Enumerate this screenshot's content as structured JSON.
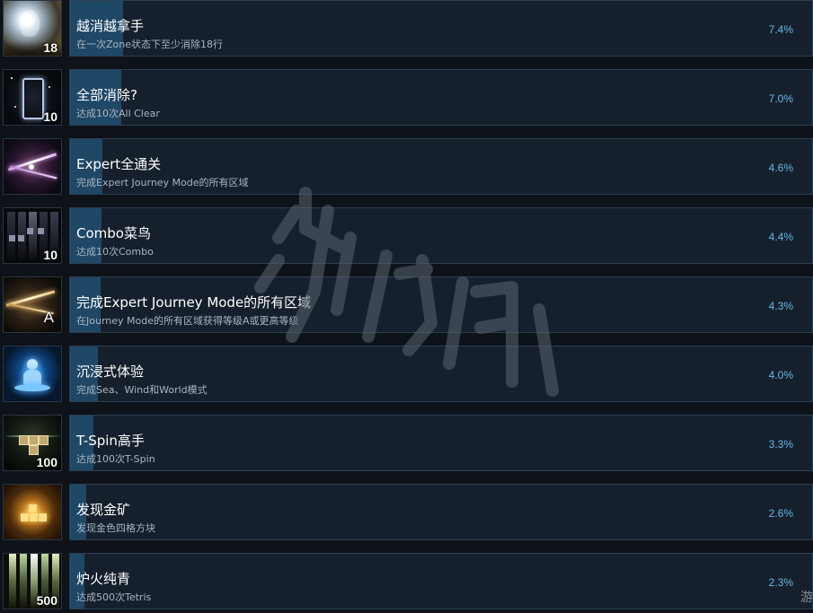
{
  "achievements": [
    {
      "title": "越消越拿手",
      "description": "在一次Zone状态下至少消除18行",
      "percent": "7.4%",
      "percent_value": 7.4,
      "icon": "head-glow-icon",
      "icon_number": "18"
    },
    {
      "title": "全部消除?",
      "description": "达成10次All Clear",
      "percent": "7.0%",
      "percent_value": 7.0,
      "icon": "empty-well-icon",
      "icon_number": "10"
    },
    {
      "title": "Expert全通关",
      "description": "完成Expert Journey Mode的所有区域",
      "percent": "4.6%",
      "percent_value": 4.6,
      "icon": "constellation-icon",
      "icon_number": ""
    },
    {
      "title": "Combo菜鸟",
      "description": "达成10次Combo",
      "percent": "4.4%",
      "percent_value": 4.4,
      "icon": "block-columns-icon",
      "icon_number": "10"
    },
    {
      "title": "完成Expert Journey Mode的所有区域",
      "description": "在Journey Mode的所有区域获得等级A或更高等级",
      "percent": "4.3%",
      "percent_value": 4.3,
      "icon": "constellation-grade-icon",
      "icon_number": "A"
    },
    {
      "title": "沉浸式体验",
      "description": "完成Sea、Wind和World模式",
      "percent": "4.0%",
      "percent_value": 4.0,
      "icon": "meditation-icon",
      "icon_number": ""
    },
    {
      "title": "T-Spin高手",
      "description": "达成100次T-Spin",
      "percent": "3.3%",
      "percent_value": 3.3,
      "icon": "t-piece-icon",
      "icon_number": "100"
    },
    {
      "title": "发现金矿",
      "description": "发现金色四格方块",
      "percent": "2.6%",
      "percent_value": 2.6,
      "icon": "gold-tetromino-icon",
      "icon_number": ""
    },
    {
      "title": "炉火纯青",
      "description": "达成500次Tetris",
      "percent": "2.3%",
      "percent_value": 2.3,
      "icon": "light-columns-icon",
      "icon_number": "500"
    }
  ],
  "watermark_label": "游侠网",
  "corner_text": "游",
  "colors": {
    "background": "#0e1219",
    "panel": "#16202c",
    "bar": "#1f4766",
    "percent": "#66b6e8"
  }
}
